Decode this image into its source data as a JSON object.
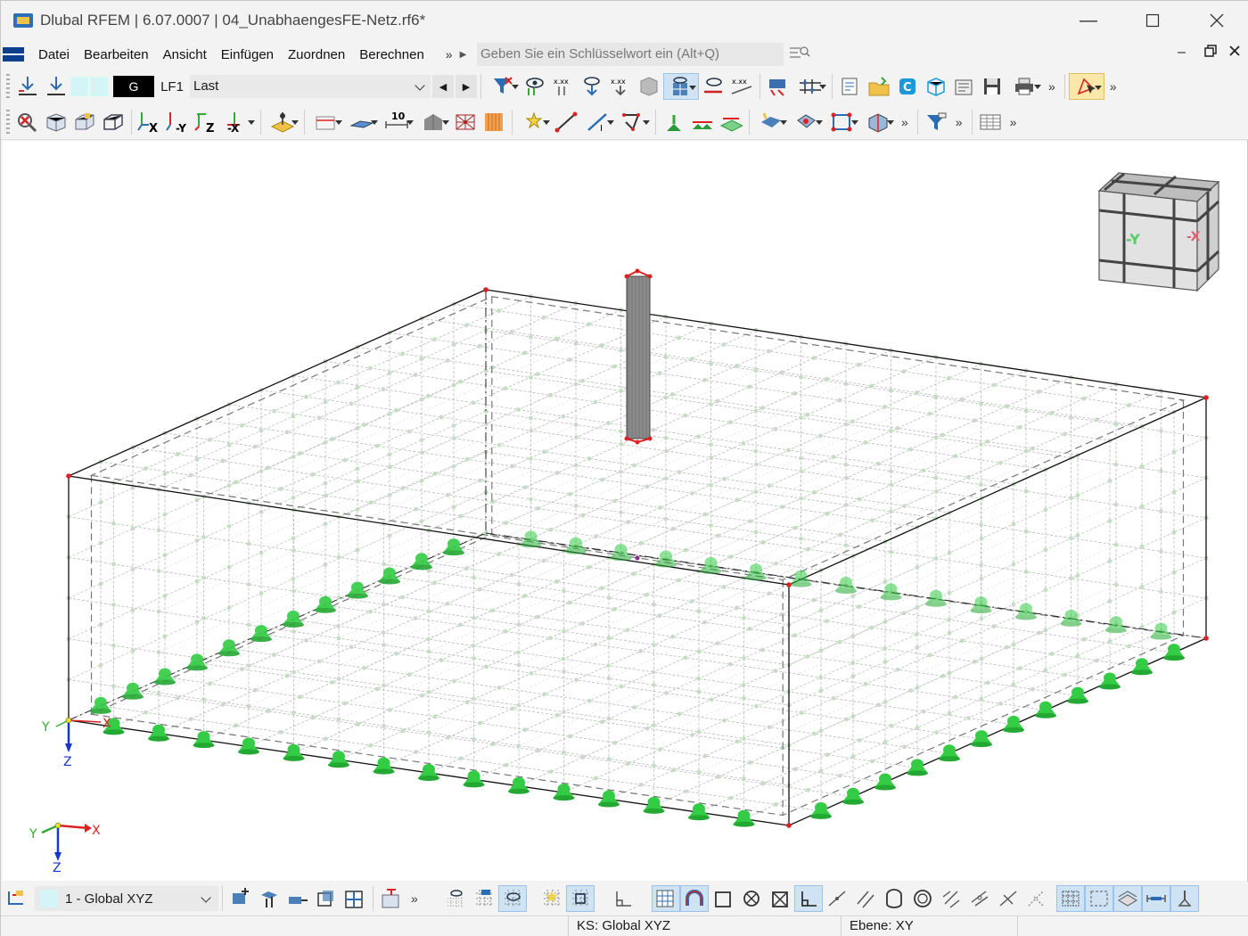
{
  "window": {
    "title": "Dlubal RFEM | 6.07.0007 | 04_UnabhaengesFE-Netz.rf6*",
    "minimize_icon": "minimize-icon",
    "maximize_icon": "maximize-icon",
    "close_icon": "close-icon"
  },
  "menu": {
    "items": [
      "Datei",
      "Bearbeiten",
      "Ansicht",
      "Einfügen",
      "Zuordnen",
      "Berechnen"
    ],
    "more": "»",
    "search_placeholder": "Geben Sie ein Schlüsselwort ein (Alt+Q)"
  },
  "loadcase": {
    "group": "G",
    "code": "LF1",
    "name": "Last"
  },
  "viewport": {
    "axes_main": {
      "x": "X",
      "y": "Y",
      "z": "Z"
    },
    "axes_corner": {
      "x": "X",
      "y": "Y",
      "z": "Z"
    },
    "navcube": {
      "front_label": "-Y",
      "side_label": "-X"
    },
    "colors": {
      "mesh_lines": "#b9b9b9",
      "mesh_nodes": "#c6ddc4",
      "supports": "#33cc44",
      "edge_lines": "#111111",
      "corner_nodes": "#e02020",
      "column": "#8c8c8c"
    }
  },
  "bottom": {
    "coordinate_system": "1 - Global XYZ"
  },
  "status": {
    "cs": "KS: Global XYZ",
    "plane": "Ebene: XY"
  }
}
